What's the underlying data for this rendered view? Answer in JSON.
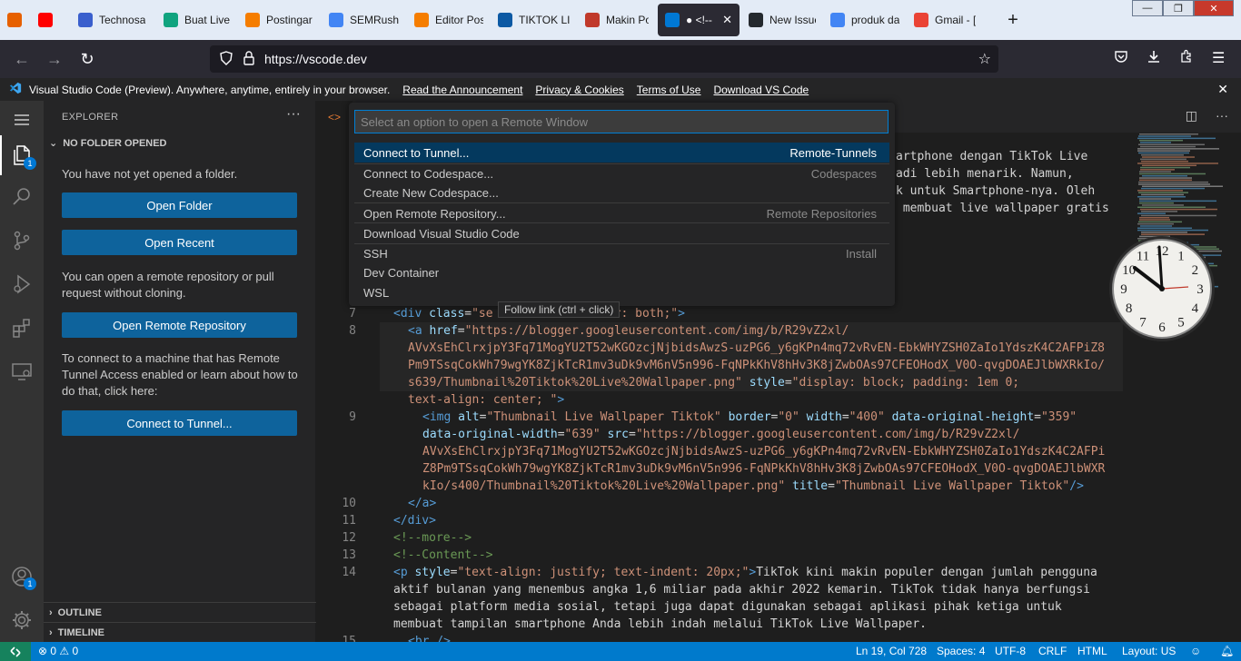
{
  "browser": {
    "tabs": [
      {
        "label": "",
        "icon": "firefox-icon",
        "color": "#e66000"
      },
      {
        "label": "",
        "icon": "youtube-icon",
        "color": "#ff0000"
      },
      {
        "label": "Technosa",
        "icon": "shield-icon",
        "color": "#3a5fcd"
      },
      {
        "label": "Buat Live",
        "icon": "chatgpt-icon",
        "color": "#10a37f"
      },
      {
        "label": "Postingar",
        "icon": "blogger-icon",
        "color": "#f57d00"
      },
      {
        "label": "SEMRush",
        "icon": "google-icon",
        "color": "#4285f4"
      },
      {
        "label": "Editor Pos",
        "icon": "blogger-icon",
        "color": "#f57d00"
      },
      {
        "label": "TIKTOK LI",
        "icon": "edge-icon",
        "color": "#0c59a4"
      },
      {
        "label": "Makin Po",
        "icon": "chart-icon",
        "color": "#c0392b"
      },
      {
        "label": "● <!--I",
        "icon": "vscode-icon",
        "color": "#0078d4"
      },
      {
        "label": "New Issue",
        "icon": "github-icon",
        "color": "#24292e"
      },
      {
        "label": "produk da",
        "icon": "google-icon",
        "color": "#4285f4"
      },
      {
        "label": "Gmail - [",
        "icon": "gmail-icon",
        "color": "#ea4335"
      }
    ],
    "url": "https://vscode.dev"
  },
  "infobar": {
    "message": "Visual Studio Code (Preview). Anywhere, anytime, entirely in your browser.",
    "links": [
      "Read the Announcement",
      "Privacy & Cookies",
      "Terms of Use",
      "Download VS Code"
    ]
  },
  "activity": {
    "explorer_badge": "1",
    "accounts_badge": "1"
  },
  "sidebar": {
    "title": "EXPLORER",
    "section": "NO FOLDER OPENED",
    "no_folder_text": "You have not yet opened a folder.",
    "open_folder": "Open Folder",
    "open_recent": "Open Recent",
    "remote_text": "You can open a remote repository or pull request without cloning.",
    "open_remote": "Open Remote Repository",
    "tunnel_text": "To connect to a machine that has Remote Tunnel Access enabled or learn about how to do that, click here:",
    "connect_tunnel": "Connect to Tunnel...",
    "outline": "OUTLINE",
    "timeline": "TIMELINE"
  },
  "quickpick": {
    "placeholder": "Select an option to open a Remote Window",
    "items": [
      {
        "label": "Connect to Tunnel...",
        "desc": "Remote-Tunnels"
      },
      {
        "label": "Connect to Codespace...",
        "desc": "Codespaces"
      },
      {
        "label": "Create New Codespace...",
        "desc": ""
      },
      {
        "label": "Open Remote Repository...",
        "desc": "Remote Repositories"
      },
      {
        "label": "Download Visual Studio Code",
        "desc": ""
      },
      {
        "label": "SSH",
        "desc": "Install"
      },
      {
        "label": "Dev Container",
        "desc": ""
      },
      {
        "label": "WSL",
        "desc": ""
      }
    ]
  },
  "tooltip": "Follow link (ctrl + click)",
  "editor": {
    "partial_lines": [
      "artphone dengan TikTok Live",
      "adi lebih menarik. Namun,",
      "k untuk Smartphone-nya. Oleh",
      " membuat live wallpaper gratis"
    ],
    "line_numbers": [
      "7",
      "8",
      "9",
      "10",
      "11",
      "12",
      "13",
      "14",
      "15"
    ]
  },
  "status": {
    "problems": "⊗ 0 ⚠ 0",
    "position": "Ln 19, Col 728",
    "spaces": "Spaces: 4",
    "encoding": "UTF-8",
    "eol": "CRLF",
    "language": "HTML",
    "layout": "Layout: US"
  }
}
